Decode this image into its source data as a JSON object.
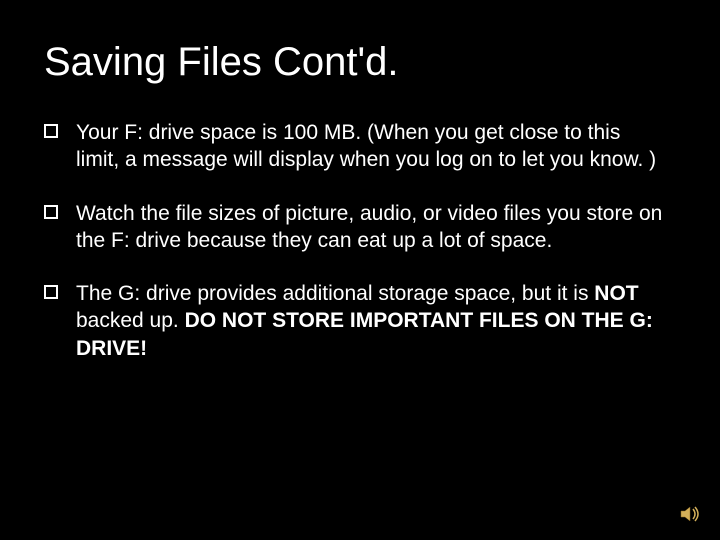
{
  "slide": {
    "title": "Saving Files Cont'd.",
    "bullets": [
      {
        "segments": [
          {
            "text": "Your F: drive space is 100 MB. (When you get close to this limit, a message will display when you log on to let you know. )",
            "bold": false
          }
        ]
      },
      {
        "segments": [
          {
            "text": "Watch the file sizes of picture, audio, or video files you store on the F: drive because they can eat up a lot of space.",
            "bold": false
          }
        ]
      },
      {
        "segments": [
          {
            "text": "The G: drive provides additional storage space, but it is ",
            "bold": false
          },
          {
            "text": "NOT",
            "bold": true
          },
          {
            "text": " backed up. ",
            "bold": false
          },
          {
            "text": "DO NOT STORE IMPORTANT FILES ON THE G: DRIVE!",
            "bold": true
          }
        ]
      }
    ]
  },
  "icons": {
    "sound": "sound-icon"
  }
}
